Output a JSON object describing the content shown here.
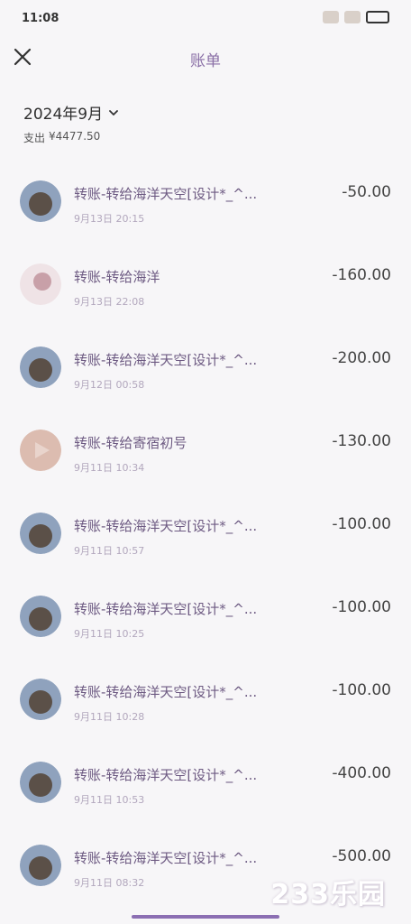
{
  "status_bar": {
    "time": "11:08"
  },
  "header": {
    "title": "账单",
    "close_icon": "close-icon"
  },
  "filter": {
    "month": "2024年9月"
  },
  "summary": {
    "label": "支出",
    "amount": "¥4477.50"
  },
  "transactions": [
    {
      "title": "转账-转给海洋天空[设计*_^...",
      "time": "9月13日 20:15",
      "amount": "-50.00",
      "avatar_color": "#7b8ca6"
    },
    {
      "title": "转账-转给海洋",
      "time": "9月13日 22:08",
      "amount": "-160.00",
      "avatar_color": "#e9d9dc"
    },
    {
      "title": "转账-转给海洋天空[设计*_^...",
      "time": "9月12日 00:58",
      "amount": "-200.00",
      "avatar_color": "#7b8ca6"
    },
    {
      "title": "转账-转给寄宿初号",
      "time": "9月11日 10:34",
      "amount": "-130.00",
      "avatar_color": "#d9b8ac"
    },
    {
      "title": "转账-转给海洋天空[设计*_^...",
      "time": "9月11日 10:57",
      "amount": "-100.00",
      "avatar_color": "#7b8ca6"
    },
    {
      "title": "转账-转给海洋天空[设计*_^...",
      "time": "9月11日 10:25",
      "amount": "-100.00",
      "avatar_color": "#7b8ca6"
    },
    {
      "title": "转账-转给海洋天空[设计*_^...",
      "time": "9月11日 10:28",
      "amount": "-100.00",
      "avatar_color": "#7b8ca6"
    },
    {
      "title": "转账-转给海洋天空[设计*_^...",
      "time": "9月11日 10:53",
      "amount": "-400.00",
      "avatar_color": "#7b8ca6"
    },
    {
      "title": "转账-转给海洋天空[设计*_^...",
      "time": "9月11日 08:32",
      "amount": "-500.00",
      "avatar_color": "#7b8ca6"
    }
  ],
  "watermark": "233乐园"
}
